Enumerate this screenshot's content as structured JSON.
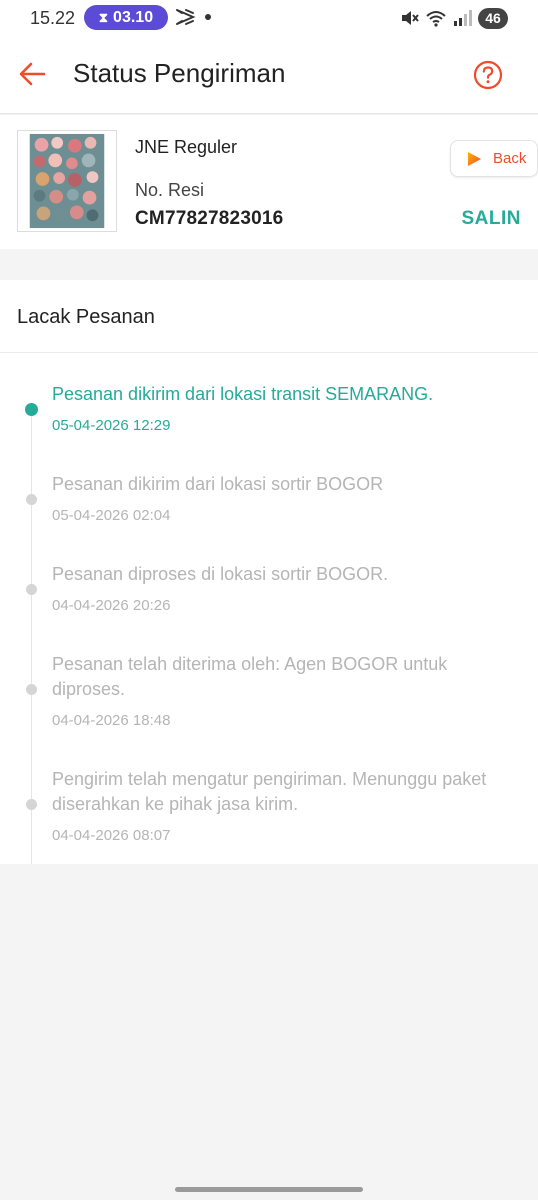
{
  "status_bar": {
    "time": "15.22",
    "timer": "03.10",
    "battery": "46"
  },
  "header": {
    "title": "Status Pengiriman"
  },
  "shipment": {
    "courier": "JNE Reguler",
    "resi_label": "No. Resi",
    "resi_number": "CM77827823016",
    "copy_label": "SALIN",
    "back_label": "Back"
  },
  "tracking": {
    "heading": "Lacak Pesanan",
    "events": [
      {
        "description": "Pesanan dikirim dari lokasi transit  SEMARANG.",
        "time": "05-04-2026 12:29",
        "active": true
      },
      {
        "description": "Pesanan dikirim dari lokasi sortir   BOGOR",
        "time": "05-04-2026 02:04",
        "active": false
      },
      {
        "description": "Pesanan diproses di lokasi sortir  BOGOR.",
        "time": "04-04-2026 20:26",
        "active": false
      },
      {
        "description": "Pesanan telah diterima oleh: Agen BOGOR untuk diproses.",
        "time": "04-04-2026 18:48",
        "active": false
      },
      {
        "description": "Pengirim telah mengatur pengiriman. Menunggu paket diserahkan ke pihak jasa kirim.",
        "time": "04-04-2026 08:07",
        "active": false
      }
    ]
  },
  "colors": {
    "accent": "#ee4d2d",
    "teal": "#26aa99",
    "inactive_text": "#b5b5b5"
  },
  "icons": {
    "back": "arrow-left-icon",
    "help": "question-circle-icon",
    "timer": "hourglass-icon",
    "play": "play-icon"
  }
}
